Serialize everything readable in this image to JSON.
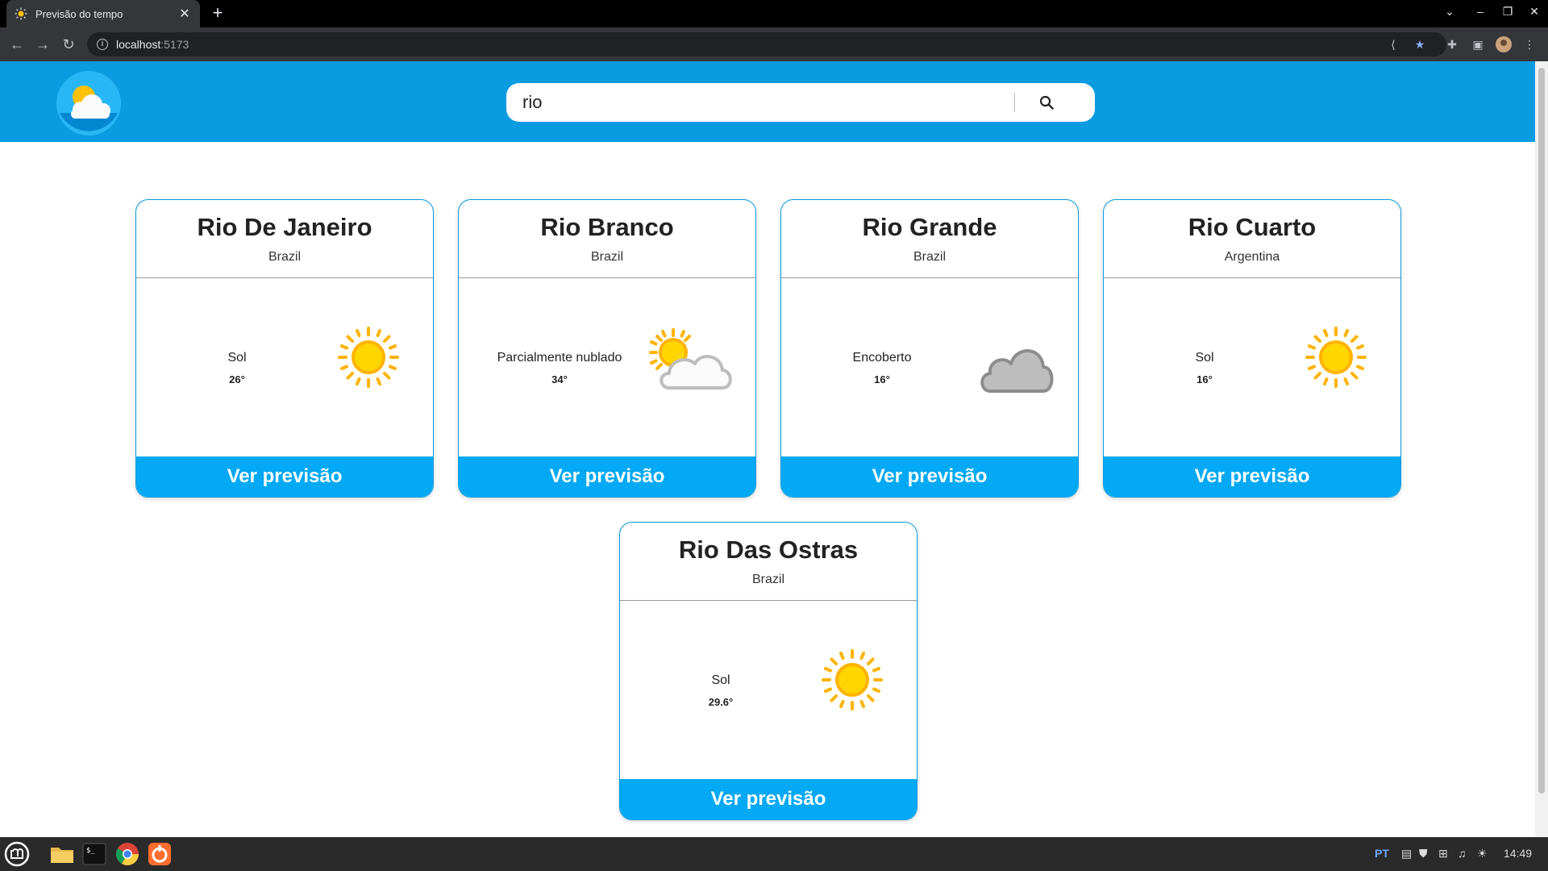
{
  "browser": {
    "tab_title": "Previsão do tempo",
    "tab_close": "✕",
    "new_tab": "+",
    "url_host": "localhost",
    "url_port": ":5173"
  },
  "search": {
    "value": "rio"
  },
  "cards": [
    {
      "city": "Rio De Janeiro",
      "country": "Brazil",
      "condition": "Sol",
      "temp": "26°",
      "icon": "sun-icon",
      "cta": "Ver previsão"
    },
    {
      "city": "Rio Branco",
      "country": "Brazil",
      "condition": "Parcialmente nublado",
      "temp": "34°",
      "icon": "partly-cloudy-icon",
      "cta": "Ver previsão"
    },
    {
      "city": "Rio Grande",
      "country": "Brazil",
      "condition": "Encoberto",
      "temp": "16°",
      "icon": "cloud-icon",
      "cta": "Ver previsão"
    },
    {
      "city": "Rio Cuarto",
      "country": "Argentina",
      "condition": "Sol",
      "temp": "16°",
      "icon": "sun-icon",
      "cta": "Ver previsão"
    },
    {
      "city": "Rio Das Ostras",
      "country": "Brazil",
      "condition": "Sol",
      "temp": "29.6°",
      "icon": "sun-icon",
      "cta": "Ver previsão"
    }
  ],
  "taskbar": {
    "lang": "PT",
    "clock": "14:49"
  },
  "colors": {
    "header": "#0a9be0",
    "button": "#03a9f4",
    "sun": "#ffc107"
  }
}
